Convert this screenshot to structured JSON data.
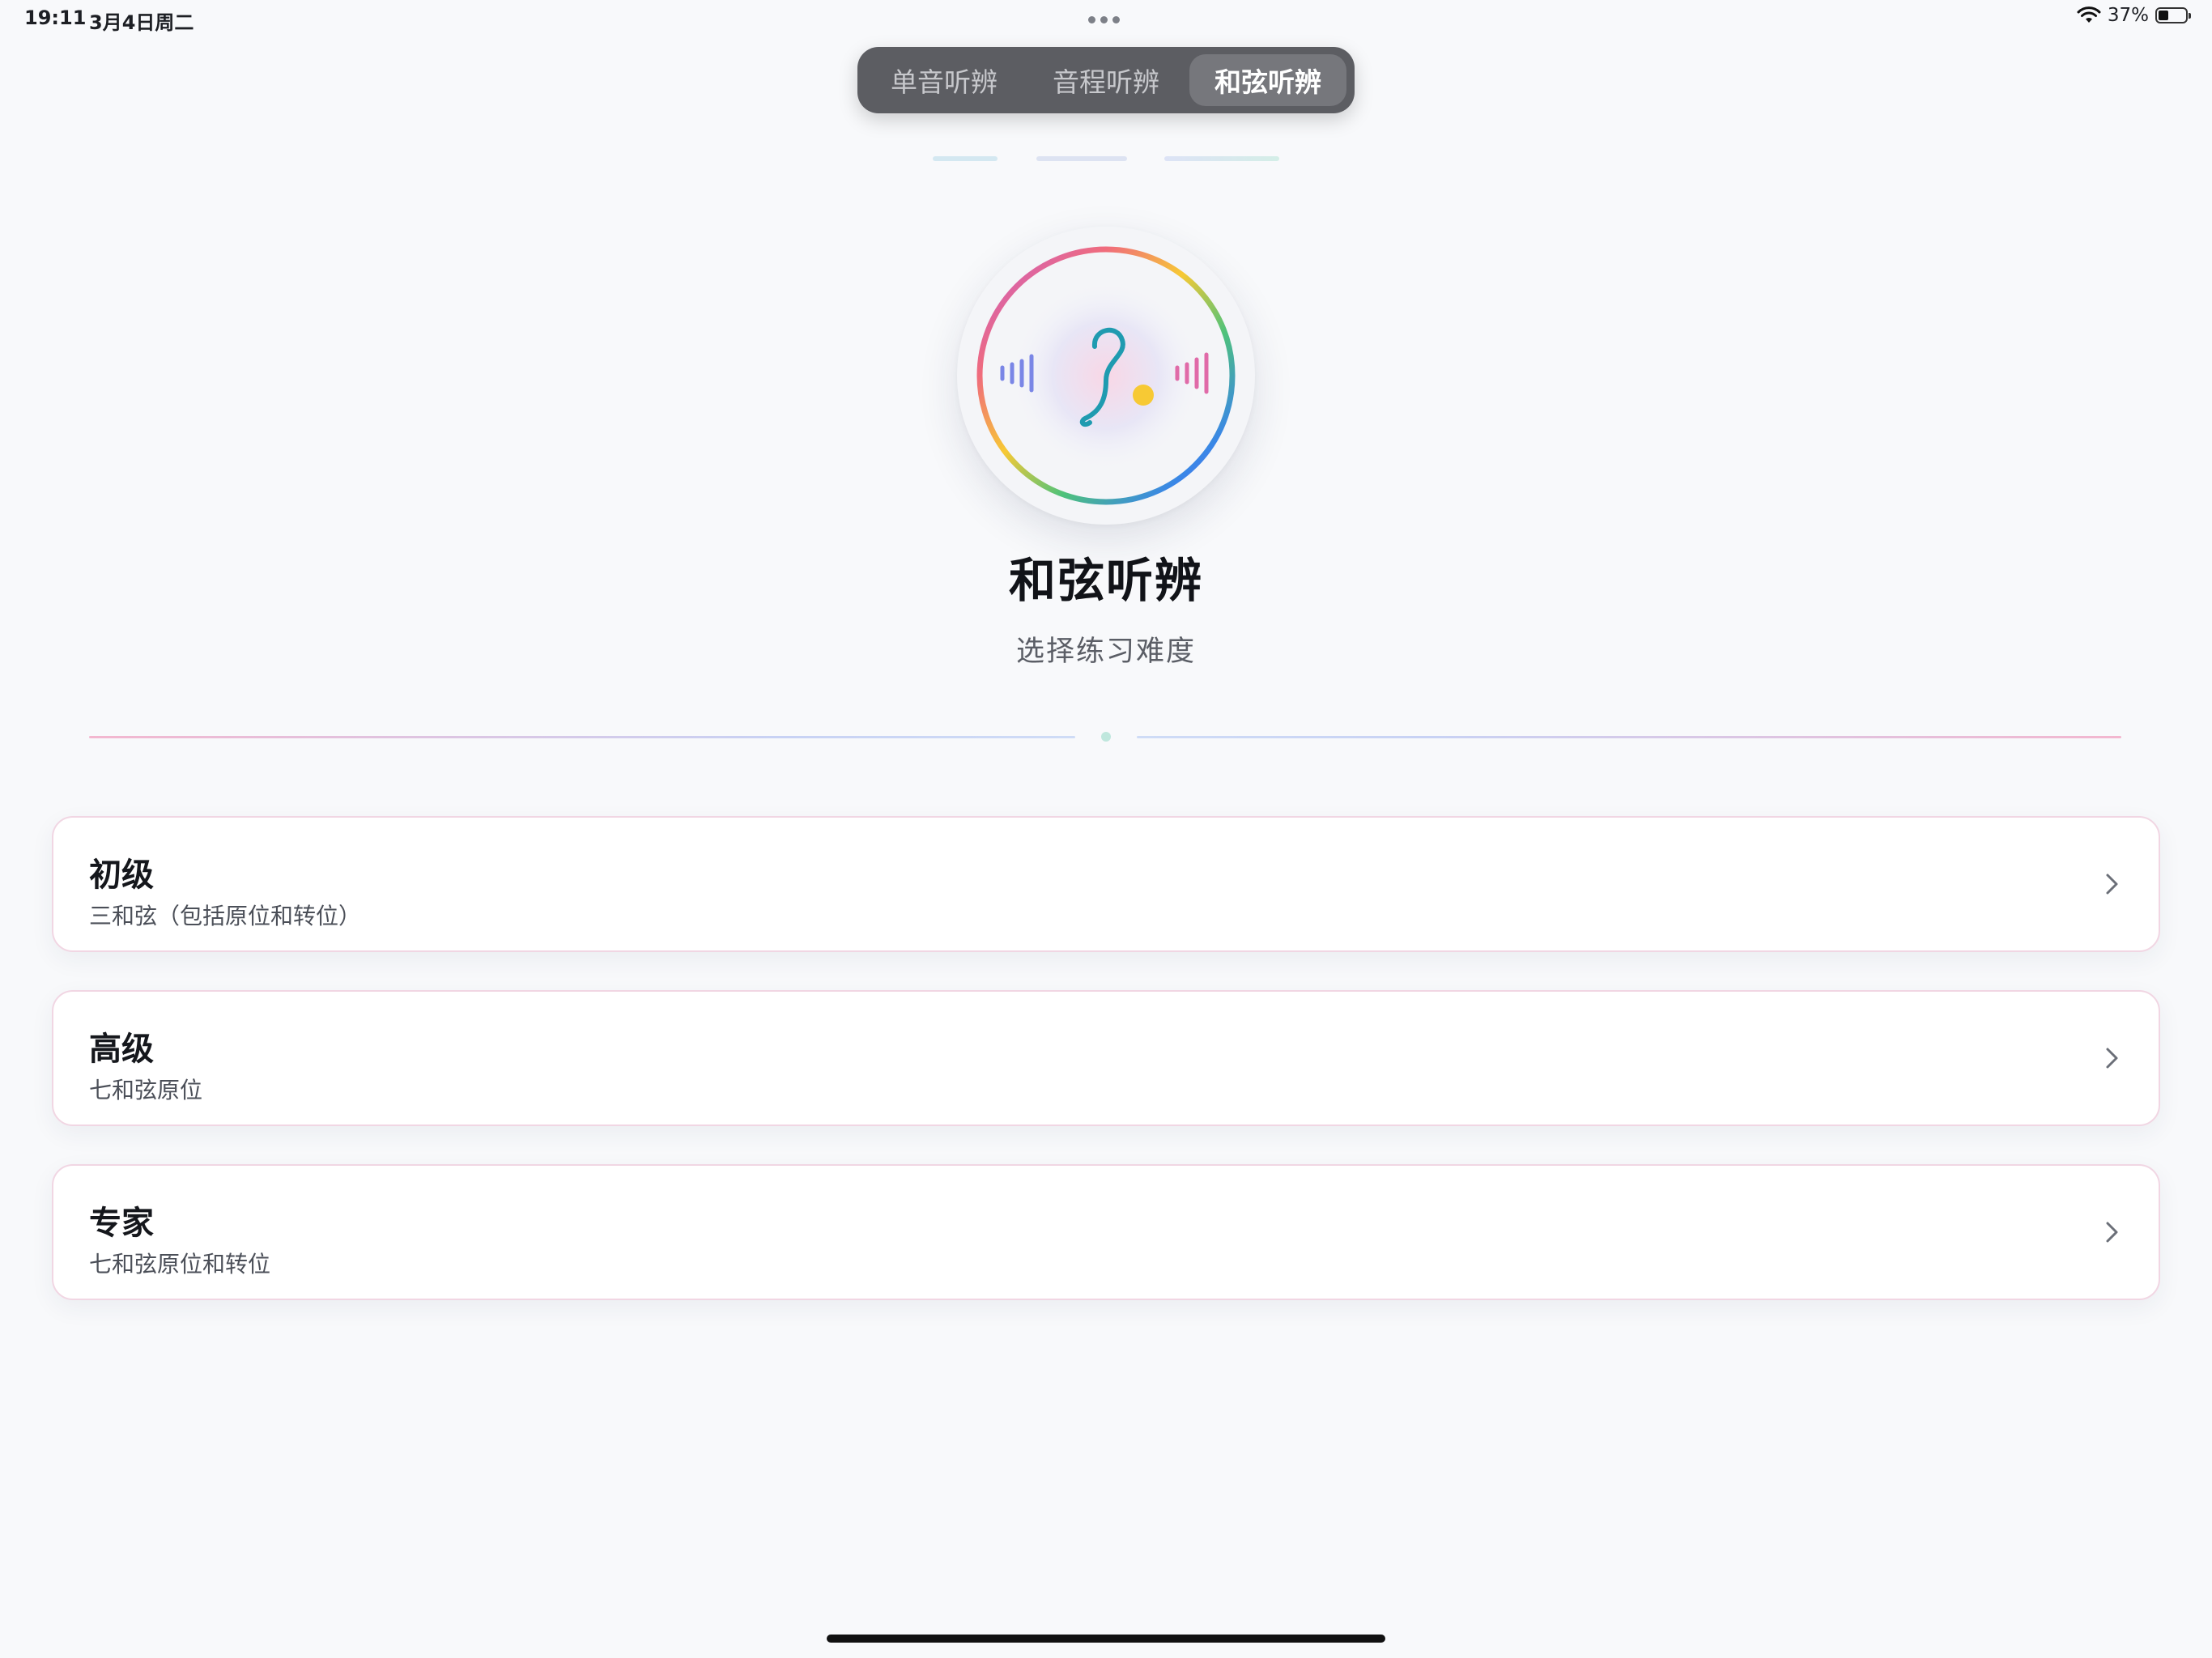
{
  "status_bar": {
    "time": "19:11",
    "date": "3月4日周二",
    "battery": "37%",
    "battery_level": 0.37
  },
  "tabs": [
    {
      "label": "单音听辨",
      "active": false
    },
    {
      "label": "音程听辨",
      "active": false
    },
    {
      "label": "和弦听辨",
      "active": true
    }
  ],
  "header": {
    "title": "和弦听辨",
    "subtitle": "选择练习难度"
  },
  "levels": [
    {
      "title": "初级",
      "desc": "三和弦（包括原位和转位）"
    },
    {
      "title": "高级",
      "desc": "七和弦原位"
    },
    {
      "title": "专家",
      "desc": "七和弦原位和转位"
    }
  ],
  "icons": {
    "wifi": "wifi-icon",
    "battery": "battery-icon",
    "logo": "ear-logo-icon",
    "chevron": "chevron-right-icon"
  },
  "colors": {
    "segment_bg": "#5c5d62",
    "segment_active": "#76777c",
    "card_border": "#f1d6e3",
    "logo_ear": "#1f9bb0",
    "logo_dot": "#f7c934"
  }
}
